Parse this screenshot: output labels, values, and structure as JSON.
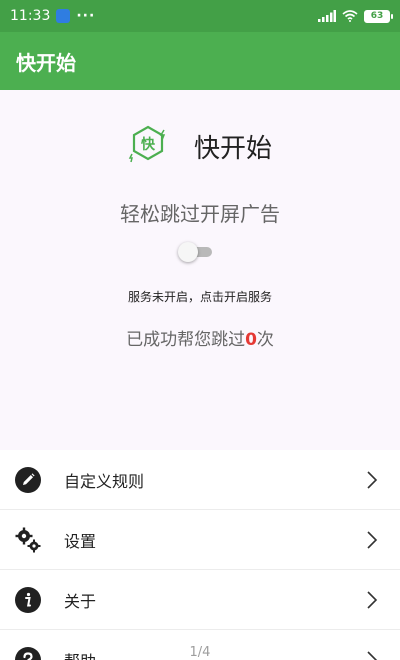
{
  "status_bar": {
    "time": "11:33",
    "dots": "···",
    "battery": "63"
  },
  "app_bar": {
    "title": "快开始"
  },
  "hero": {
    "logo_text": "快",
    "app_name": "快开始",
    "tagline": "轻松跳过开屏广告",
    "service_enabled": false,
    "service_status": "服务未开启，点击开启服务",
    "skip_prefix": "已成功帮您跳过",
    "skip_count": "0",
    "skip_suffix": "次"
  },
  "menu": {
    "items": [
      {
        "label": "自定义规则",
        "icon": "pencil-icon"
      },
      {
        "label": "设置",
        "icon": "gears-icon"
      },
      {
        "label": "关于",
        "icon": "info-icon"
      },
      {
        "label": "帮助",
        "icon": "help-icon"
      }
    ]
  },
  "page_indicator": "1/4",
  "colors": {
    "status_bar": "#43a047",
    "app_bar": "#4caf50",
    "accent_red": "#e53935",
    "hero_bg": "#fbf7fd"
  }
}
